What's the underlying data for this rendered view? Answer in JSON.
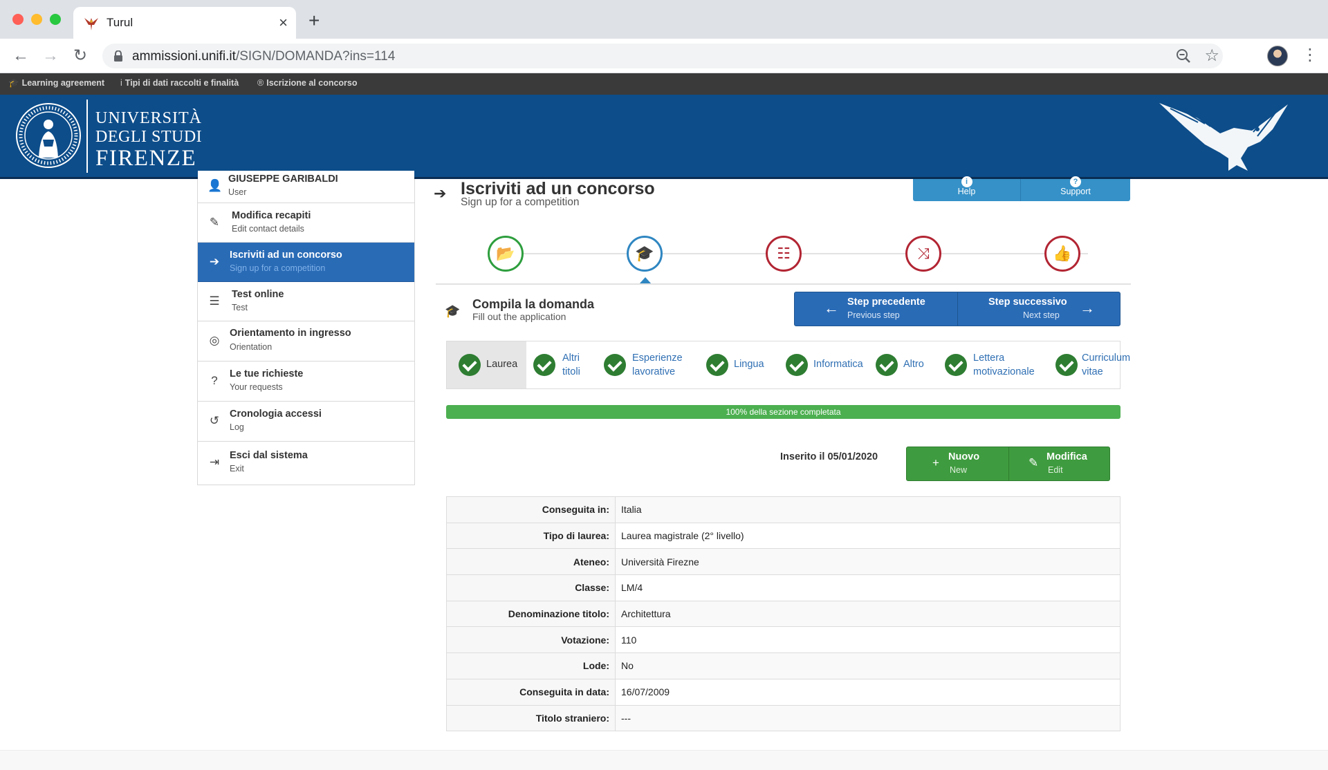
{
  "browser": {
    "tab_title": "Turul",
    "close_glyph": "×",
    "new_tab_glyph": "+",
    "url_host": "ammissioni.unifi.it",
    "url_path": "/SIGN/DOMANDA?ins=114",
    "back_glyph": "←",
    "forward_glyph": "→",
    "reload_glyph": "↻",
    "star_glyph": "☆",
    "menu_glyph": "⋮",
    "icons": [
      "favicon-eagle-icon",
      "lock-icon",
      "zoom-icon",
      "star-icon",
      "menu-dots-icon"
    ]
  },
  "utility_bar": {
    "items": [
      {
        "icon": "graduation-cap-icon",
        "glyph": "🎓",
        "label": "Learning agreement"
      },
      {
        "icon": "info-icon",
        "glyph": "i",
        "label": "Tipi di dati raccolti e finalità"
      },
      {
        "icon": "registered-icon",
        "glyph": "®",
        "label": "Iscrizione al concorso"
      }
    ]
  },
  "header": {
    "brand_line1": "UNIVERSITÀ",
    "brand_line2": "DEGLI STUDI",
    "brand_line3": "FIRENZE",
    "colors": {
      "header_bg": "#0d4d8a"
    }
  },
  "sidebar": {
    "items": [
      {
        "title": "GIUSEPPE GARIBALDI",
        "subtitle": "User",
        "icon": "user-icon",
        "glyph": "👤"
      },
      {
        "title": "Modifica recapiti",
        "subtitle": "Edit contact details",
        "icon": "edit-icon",
        "glyph": "✎"
      },
      {
        "title": "Iscriviti ad un concorso",
        "subtitle": "Sign up for a competition",
        "icon": "sign-in-icon",
        "glyph": "➔"
      },
      {
        "title": "Test online",
        "subtitle": "Test",
        "icon": "list-icon",
        "glyph": "☰"
      },
      {
        "title": "Orientamento in ingresso",
        "subtitle": "Orientation",
        "icon": "compass-icon",
        "glyph": "◎"
      },
      {
        "title": "Le tue richieste",
        "subtitle": "Your requests",
        "icon": "question-icon",
        "glyph": "?"
      },
      {
        "title": "Cronologia accessi",
        "subtitle": "Log",
        "icon": "history-icon",
        "glyph": "↺"
      },
      {
        "title": "Esci dal sistema",
        "subtitle": "Exit",
        "icon": "logout-icon",
        "glyph": "⇥"
      }
    ],
    "active_index": 2
  },
  "page": {
    "title": "Iscriviti ad un concorso",
    "subtitle": "Sign up for a competition",
    "icon_glyph": "➔",
    "help_label": "Help",
    "support_label": "Support",
    "help_glyph": "i",
    "support_glyph": "?"
  },
  "stepper": {
    "steps": [
      {
        "icon": "folder-open-icon",
        "glyph": "📂",
        "status": "done"
      },
      {
        "icon": "graduation-cap-icon",
        "glyph": "🎓",
        "status": "current"
      },
      {
        "icon": "list-icon",
        "glyph": "☷",
        "status": "todo"
      },
      {
        "icon": "shuffle-icon",
        "glyph": "⤨",
        "status": "todo"
      },
      {
        "icon": "thumbs-up-icon",
        "glyph": "👍",
        "status": "todo"
      }
    ]
  },
  "section": {
    "title": "Compila la domanda",
    "subtitle": "Fill out the application",
    "icon_glyph": "🎓",
    "prev_title": "Step precedente",
    "prev_sub": "Previous step",
    "next_title": "Step successivo",
    "next_sub": "Next step",
    "prev_arrow": "←",
    "next_arrow": "→"
  },
  "subtabs": [
    {
      "lines": [
        "Laurea"
      ],
      "active": true
    },
    {
      "lines": [
        "Altri",
        "titoli"
      ],
      "active": false
    },
    {
      "lines": [
        "Esperienze",
        "lavorative"
      ],
      "active": false
    },
    {
      "lines": [
        "Lingua"
      ],
      "active": false
    },
    {
      "lines": [
        "Informatica"
      ],
      "active": false
    },
    {
      "lines": [
        "Altro"
      ],
      "active": false
    },
    {
      "lines": [
        "Lettera",
        "motivazionale"
      ],
      "active": false
    },
    {
      "lines": [
        "Curriculum",
        "vitae"
      ],
      "active": false
    }
  ],
  "progress": {
    "value": 100,
    "label": "100% della sezione completata"
  },
  "record": {
    "inserted_label": "Inserito il 05/01/2020",
    "new_title": "Nuovo",
    "new_sub": "New",
    "edit_title": "Modifica",
    "edit_sub": "Edit",
    "new_glyph": "+",
    "edit_glyph": "✎"
  },
  "details": [
    {
      "label": "Conseguita in:",
      "value": "Italia"
    },
    {
      "label": "Tipo di laurea:",
      "value": "Laurea magistrale (2° livello)"
    },
    {
      "label": "Ateneo:",
      "value": "Università Firezne"
    },
    {
      "label": "Classe:",
      "value": "LM/4"
    },
    {
      "label": "Denominazione titolo:",
      "value": "Architettura"
    },
    {
      "label": "Votazione:",
      "value": "110"
    },
    {
      "label": "Lode:",
      "value": "No"
    },
    {
      "label": "Conseguita in data:",
      "value": "16/07/2009"
    },
    {
      "label": "Titolo straniero:",
      "value": "---"
    }
  ]
}
